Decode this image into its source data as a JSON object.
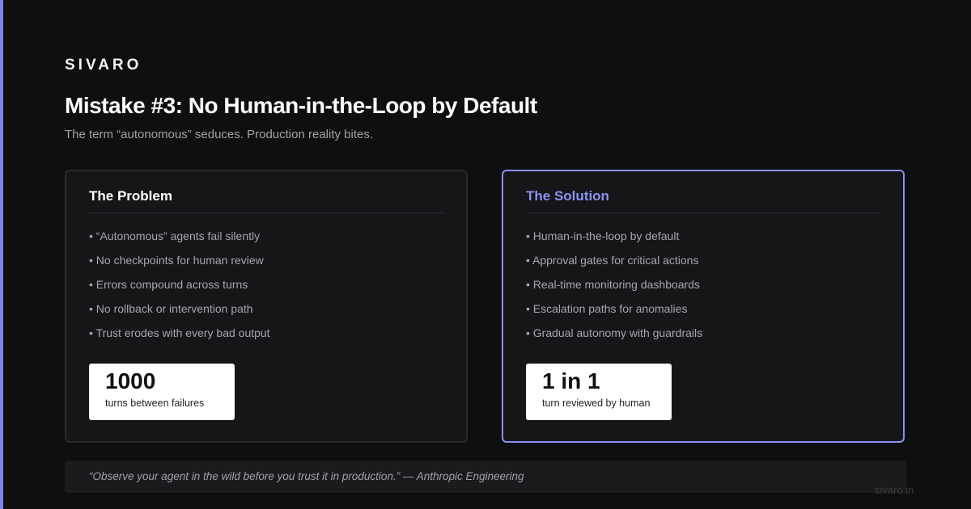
{
  "brand": "SIVARO",
  "title": "Mistake #3: No Human-in-the-Loop by Default",
  "subtitle": "The term “autonomous” seduces. Production reality bites.",
  "problem": {
    "heading": "The Problem",
    "items": [
      "• “Autonomous” agents fail silently",
      "• No checkpoints for human review",
      "• Errors compound across turns",
      "• No rollback or intervention path",
      "• Trust erodes with every bad output"
    ],
    "stat_value": "1000",
    "stat_label": "turns between failures"
  },
  "solution": {
    "heading": "The Solution",
    "items": [
      "• Human-in-the-loop by default",
      "• Approval gates for critical actions",
      "• Real-time monitoring dashboards",
      "• Escalation paths for anomalies",
      "• Gradual autonomy with guardrails"
    ],
    "stat_value": "1 in 1",
    "stat_label": "turn reviewed by human"
  },
  "quote": "“Observe your agent in the wild before you trust it in production.” — Anthropic Engineering",
  "footer": "sivaro.in",
  "colors": {
    "background": "#0f0f10",
    "accent": "#7b83f0",
    "solution_heading": "#8a92f2",
    "card_background": "#161619",
    "stat_background": "#ffffff"
  }
}
